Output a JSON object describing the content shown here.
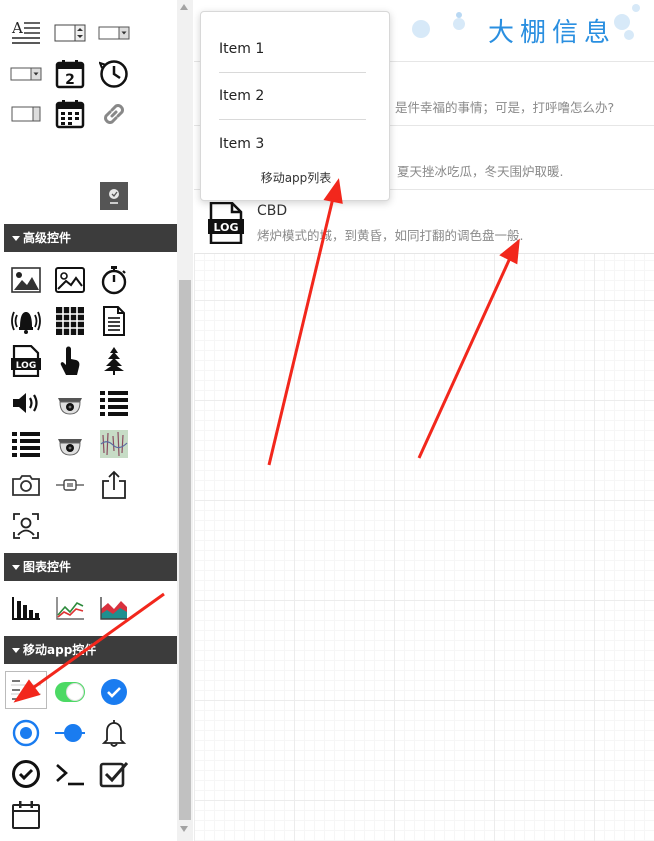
{
  "palette": {
    "sections": {
      "advanced": "高级控件",
      "charts": "图表控件",
      "mobile": "移动app控件"
    }
  },
  "banner": {
    "title": "大棚信息"
  },
  "dropdown": {
    "items": [
      "Item 1",
      "Item 2",
      "Item 3"
    ],
    "footer": "移动app列表"
  },
  "list": {
    "rows": [
      {
        "title": "",
        "desc": "是件幸福的事情；可是，打呼噜怎么办?"
      },
      {
        "title": "",
        "desc": "夏天挫冰吃瓜，冬天围炉取暖."
      },
      {
        "title": "CBD",
        "desc": "烤炉模式的城，到黄昏，如同打翻的调色盘一般."
      }
    ],
    "icon": "log-file-icon"
  },
  "colors": {
    "accent": "#2a8fe0",
    "header_bg": "#3c3c3c",
    "arrow": "#f2271c",
    "toggle_green": "#4cd964",
    "ios_blue": "#1a7cf0"
  }
}
